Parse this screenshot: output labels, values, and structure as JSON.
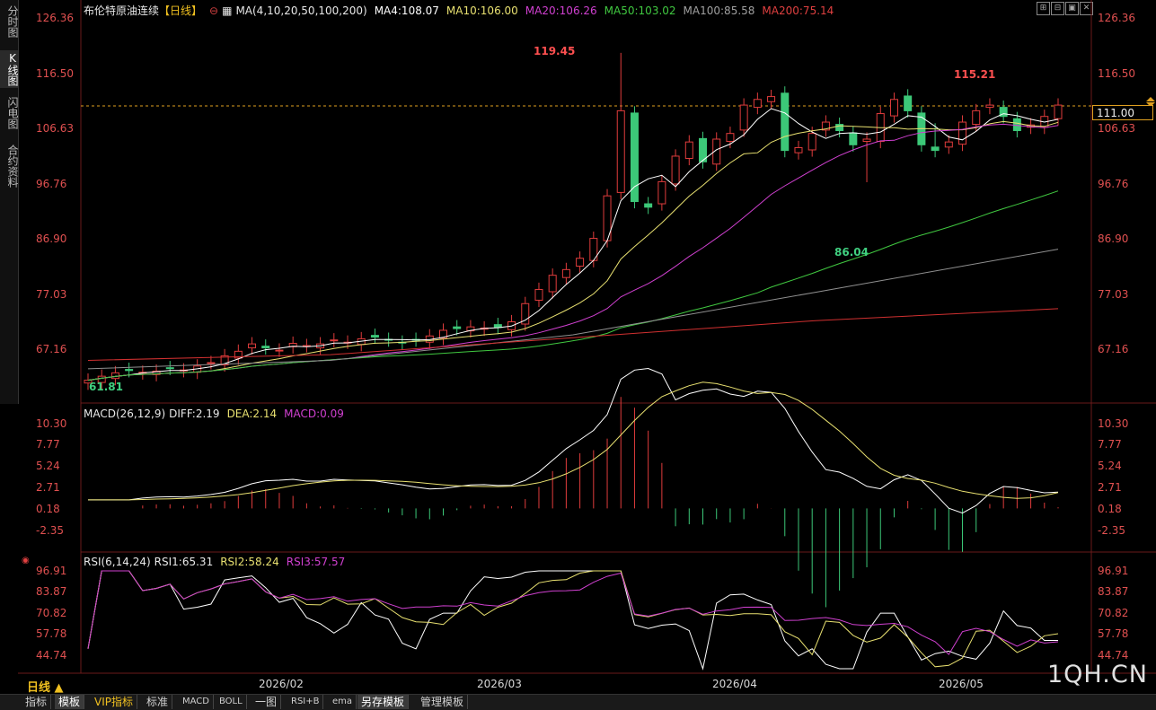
{
  "header": {
    "title": "布伦特原油连续",
    "period_tag": "【日线】",
    "ma_label": "MA(4,10,20,50,100,200)",
    "ma4": "MA4:108.07",
    "ma10": "MA10:106.00",
    "ma20": "MA20:106.26",
    "ma50": "MA50:103.02",
    "ma100": "MA100:85.58",
    "ma200": "MA200:75.14"
  },
  "left_tabs": [
    "分时图",
    "K线图",
    "闪电图",
    "合约资料"
  ],
  "price_axis": [
    "126.36",
    "116.50",
    "106.63",
    "96.76",
    "86.90",
    "77.03",
    "67.16"
  ],
  "price_annotations": {
    "high1": "119.45",
    "high2": "115.21",
    "low1": "86.04",
    "low2": "61.81"
  },
  "current_price": "111.00",
  "macd": {
    "label": "MACD(26,12,9)",
    "diff": "DIFF:2.19",
    "dea": "DEA:2.14",
    "macd": "MACD:0.09",
    "axis": [
      "10.30",
      "7.77",
      "5.24",
      "2.71",
      "0.18",
      "-2.35"
    ]
  },
  "rsi": {
    "label": "RSI(6,14,24)",
    "rsi1": "RSI1:65.31",
    "rsi2": "RSI2:58.24",
    "rsi3": "RSI3:57.57",
    "axis": [
      "96.91",
      "83.87",
      "70.82",
      "57.78",
      "44.74"
    ]
  },
  "x_axis": [
    "2026/02",
    "2026/03",
    "2026/04",
    "2026/05"
  ],
  "day_label": "日线 ▲",
  "bottom_tabs": [
    "指标",
    "模板",
    "VIP指标",
    "标准",
    "MACD",
    "BOLL",
    "一图",
    "RSI+B",
    "ema",
    "另存模板",
    "管理模板"
  ],
  "watermark": "1QH.CN",
  "colors": {
    "up": "#e03c3c",
    "down": "#3cc878",
    "ma4": "#ffffff",
    "ma10": "#e8e070",
    "ma20": "#d040d0",
    "ma50": "#40c840",
    "ma100": "#909090",
    "ma200": "#d03030",
    "axis_text": "#e05050"
  }
}
